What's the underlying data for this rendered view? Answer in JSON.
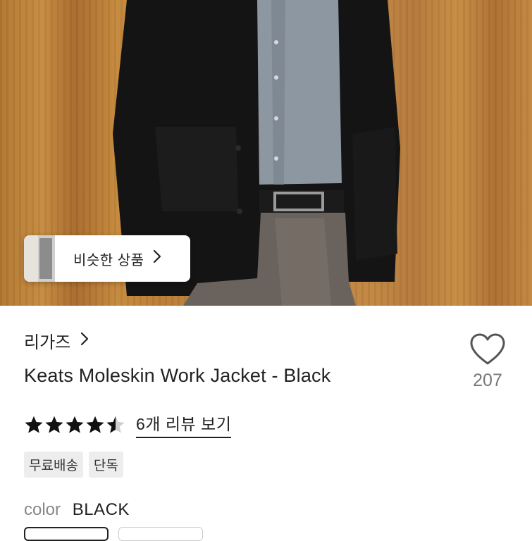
{
  "similar": {
    "label": "비슷한 상품",
    "chevron": "chevron-right-icon"
  },
  "product": {
    "brand": "리가즈",
    "brand_chevron": "chevron-right-icon",
    "title": "Keats Moleskin Work Jacket - Black",
    "likes": "207",
    "rating": 4.5,
    "reviews_label": "6개 리뷰 보기",
    "tags": [
      "무료배송",
      "단독"
    ],
    "color_label": "color",
    "color_value": "BLACK"
  },
  "colors": {
    "star": "#111111",
    "heart": "#555555",
    "tag_bg": "#ededed"
  }
}
